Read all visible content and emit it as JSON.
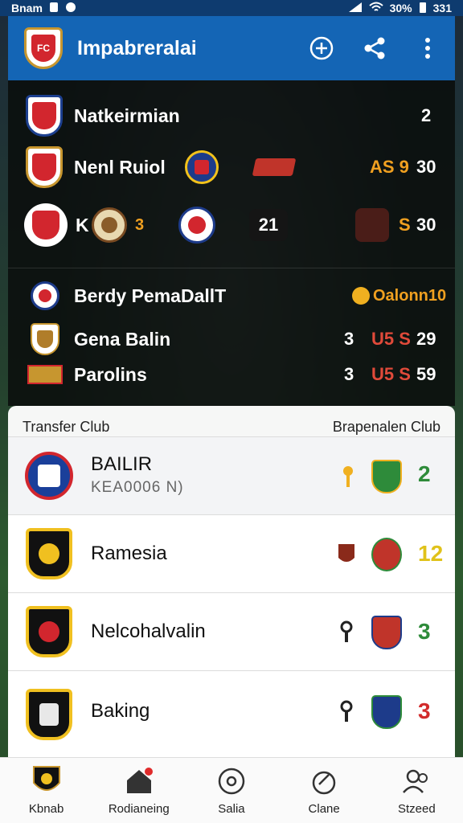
{
  "status_bar": {
    "left_text": "Bnam",
    "battery": "30%",
    "time": "331"
  },
  "app_bar": {
    "title": "Impabreralai",
    "actions": [
      "add-icon",
      "share-icon",
      "more-icon"
    ]
  },
  "matches": [
    {
      "team": "Natkeirmian",
      "score_right": "2"
    },
    {
      "team": "Nenl Ruiol",
      "score_mid": "AS 9",
      "score_right": "30"
    },
    {
      "team": "K",
      "team_extra": "3",
      "center_score": "21",
      "score_mid": "S",
      "score_right": "30"
    },
    {
      "team": "Berdy PemaDallT",
      "badge": "Oalonn10"
    },
    {
      "team": "Gena Balin",
      "score_left": "3",
      "score_mid": "U5 S",
      "score_right": "29"
    },
    {
      "team": "Parolins",
      "score_left": "3",
      "score_mid": "U5 S",
      "score_right": "59"
    }
  ],
  "sheet": {
    "header_left": "Transfer Club",
    "header_right": "Brapenalen Club",
    "clubs": [
      {
        "name": "BAILIR",
        "subtitle": "KEA0006 N)",
        "score": "2",
        "score_color": "#2e8b3a"
      },
      {
        "name": "Ramesia",
        "score": "12",
        "score_color": "#e0c21a"
      },
      {
        "name": "Nelcohalvalin",
        "score": "3",
        "score_color": "#2e8b3a"
      },
      {
        "name": "Baking",
        "score": "3",
        "score_color": "#d22b2b"
      }
    ]
  },
  "bottom_nav": [
    {
      "label": "Kbnab",
      "icon": "club-crest-icon"
    },
    {
      "label": "Rodianeing",
      "icon": "home-icon"
    },
    {
      "label": "Salia",
      "icon": "circle-target-icon"
    },
    {
      "label": "Clane",
      "icon": "chart-gauge-icon"
    },
    {
      "label": "Stzeed",
      "icon": "people-icon"
    }
  ],
  "colors": {
    "app_bar": "#1465b5",
    "status_bar": "#0e3b6f",
    "orange_score": "#f0a020",
    "red_score": "#e04a3a"
  }
}
